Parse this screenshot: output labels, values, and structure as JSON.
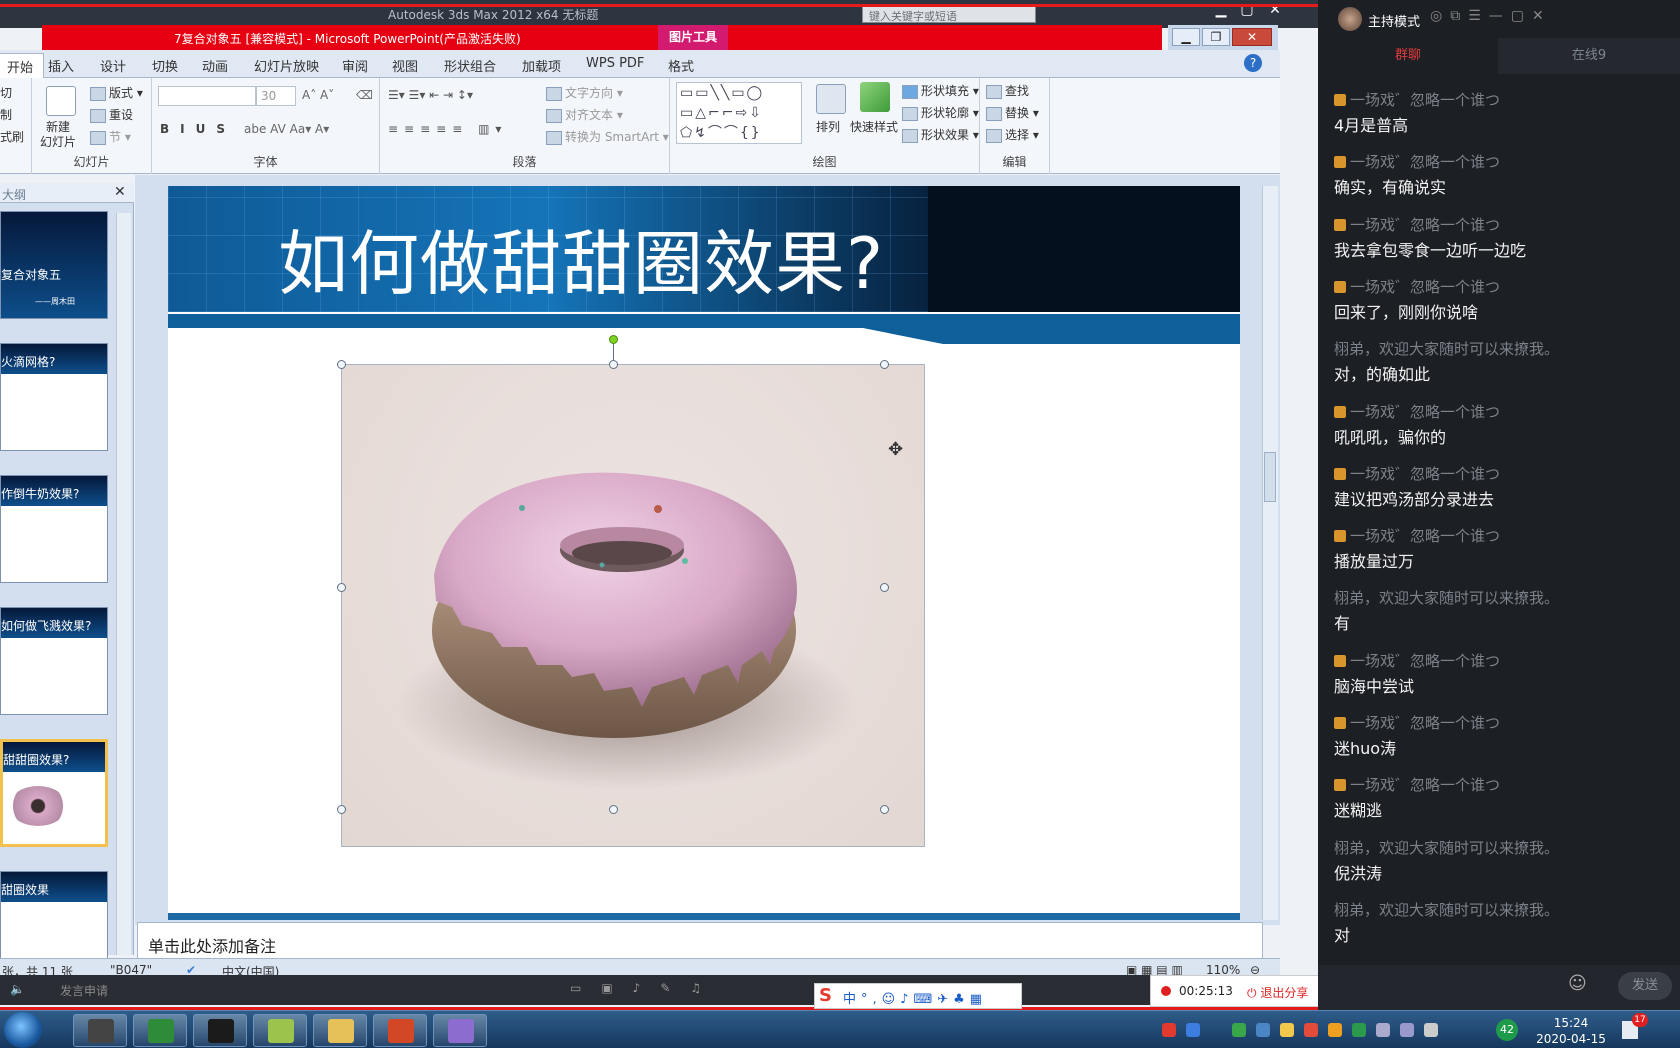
{
  "max_titlebar": {
    "title": "Autodesk 3ds Max  2012 x64      无标题",
    "search_placeholder": "键入关键字或短语"
  },
  "ppt": {
    "title": "7复合对象五 [兼容模式] - Microsoft PowerPoint(产品激活失败)",
    "context_tool": "图片工具",
    "tabs": [
      "开始",
      "插入",
      "设计",
      "切换",
      "动画",
      "幻灯片放映",
      "审阅",
      "视图",
      "形状组合",
      "加载项",
      "WPS PDF",
      "格式"
    ]
  },
  "ribbon": {
    "clipboard": {
      "cut": "切",
      "copy": "制",
      "format_painter": "式刷"
    },
    "slides": {
      "new_slide": "新建\n幻灯片",
      "layout": "版式",
      "reset": "重设",
      "section": "节",
      "group_label": "幻灯片"
    },
    "font": {
      "font_size": "30",
      "group_label": "字体"
    },
    "paragraph": {
      "text_direction": "文字方向",
      "align_text": "对齐文本",
      "convert_smartart": "转换为 SmartArt",
      "group_label": "段落"
    },
    "drawing": {
      "arrange": "排列",
      "quick_styles": "快速样式",
      "shape_fill": "形状填充",
      "shape_outline": "形状轮廓",
      "shape_effects": "形状效果",
      "group_label": "绘图"
    },
    "editing": {
      "find": "查找",
      "replace": "替换",
      "select": "选择",
      "group_label": "编辑"
    }
  },
  "slide_panel": {
    "header": "大纲",
    "thumbnails": [
      {
        "label": "复合对象五",
        "sub": "——周木田"
      },
      {
        "label": "火滴网格?"
      },
      {
        "label": "作倒牛奶效果?"
      },
      {
        "label": "如何做飞溅效果?"
      },
      {
        "label": "甜甜圈效果?"
      },
      {
        "label": "甜圈效果"
      }
    ]
  },
  "slide": {
    "title": "如何做甜甜圈效果?"
  },
  "notes_placeholder": "单击此处添加备注",
  "status": {
    "slide_count": "张，共 11 张",
    "theme": "\"B047\"",
    "language": "中文(中国)",
    "zoom": "110%"
  },
  "chat": {
    "mode": "主持模式",
    "tab_group": "群聊",
    "tab_online": "在线9",
    "messages": [
      {
        "user": "一场戏゛忽略一个谁つ",
        "text": "4月是普高",
        "crown": true
      },
      {
        "user": "一场戏゛忽略一个谁つ",
        "text": "确实，有确说实",
        "crown": true
      },
      {
        "user": "一场戏゛忽略一个谁つ",
        "text": "我去拿包零食一边听一边吃",
        "crown": true
      },
      {
        "user": "一场戏゛忽略一个谁つ",
        "text": "回来了，刚刚你说啥",
        "crown": true
      },
      {
        "user": "栩弟，欢迎大家随时可以来撩我。",
        "text": "对，的确如此",
        "crown": false
      },
      {
        "user": "一场戏゛忽略一个谁つ",
        "text": "吼吼吼，骗你的",
        "crown": true
      },
      {
        "user": "一场戏゛忽略一个谁つ",
        "text": "建议把鸡汤部分录进去",
        "crown": true
      },
      {
        "user": "一场戏゛忽略一个谁つ",
        "text": "播放量过万",
        "crown": true
      },
      {
        "user": "栩弟，欢迎大家随时可以来撩我。",
        "text": "有",
        "crown": false
      },
      {
        "user": "一场戏゛忽略一个谁つ",
        "text": "脑海中尝试",
        "crown": true
      },
      {
        "user": "一场戏゛忽略一个谁つ",
        "text": "迷huo涛",
        "crown": true
      },
      {
        "user": "一场戏゛忽略一个谁つ",
        "text": "迷糊逃",
        "crown": true
      },
      {
        "user": "栩弟，欢迎大家随时可以来撩我。",
        "text": "倪洪涛",
        "crown": false
      },
      {
        "user": "栩弟，欢迎大家随时可以来撩我。",
        "text": "对",
        "crown": false
      }
    ],
    "send_label": "发送"
  },
  "recording": {
    "timer": "00:25:13",
    "exit_label": "退出分享"
  },
  "mic_bar": {
    "apply_label": "发言申请"
  },
  "taskbar": {
    "time": "15:24",
    "date": "2020-04-15",
    "badge": "17",
    "tray_number": "42"
  }
}
